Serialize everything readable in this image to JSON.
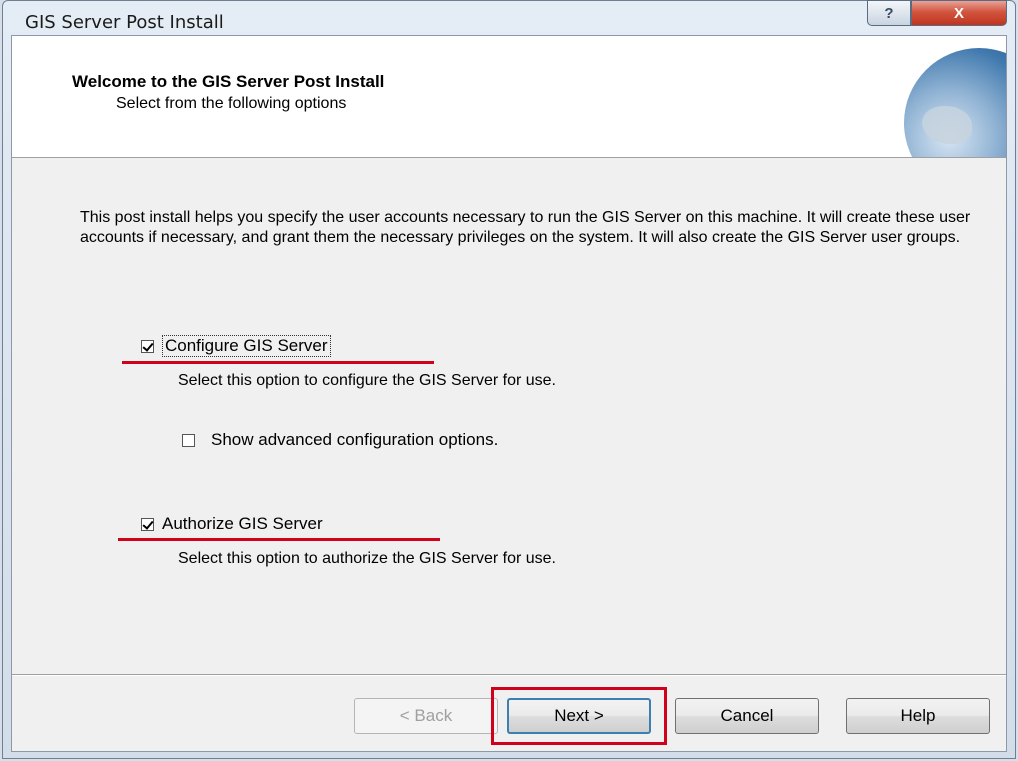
{
  "window": {
    "title": "GIS Server Post Install"
  },
  "titlebar": {
    "help_glyph": "?",
    "close_glyph": "X"
  },
  "header": {
    "title": "Welcome to the GIS Server Post Install",
    "subtitle": "Select from the following options",
    "image_icon": "globe-image"
  },
  "intro": {
    "text": "This post install helps you specify the user accounts necessary to run the GIS Server on this machine. It will create these user accounts if necessary, and grant them the necessary privileges on the system.  It will also create the GIS Server user groups."
  },
  "options": {
    "configure": {
      "label": "Configure GIS Server",
      "checked": true,
      "description": "Select this option to configure the GIS Server for use."
    },
    "advanced": {
      "label": "Show advanced configuration options.",
      "checked": false
    },
    "authorize": {
      "label": "Authorize GIS Server",
      "checked": true,
      "description": "Select this option to authorize the GIS Server for use."
    }
  },
  "buttons": {
    "back": "< Back",
    "next": "Next >",
    "cancel": "Cancel",
    "help": "Help"
  },
  "annotation_color": "#d0021b"
}
